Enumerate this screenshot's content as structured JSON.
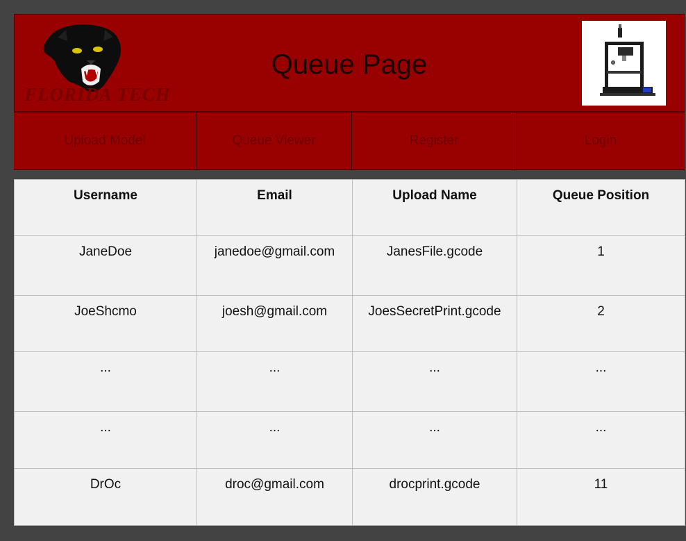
{
  "header": {
    "title": "Queue Page",
    "logo_text": "FLORIDA TECH",
    "colors": {
      "brand": "#990000",
      "nav": "#990000",
      "background": "#434343",
      "table": "#f1f1f1"
    }
  },
  "nav": {
    "items": [
      {
        "label": "Upload Model"
      },
      {
        "label": "Queue Viewer"
      },
      {
        "label": "Register"
      },
      {
        "label": "Login"
      }
    ]
  },
  "table": {
    "columns": [
      "Username",
      "Email",
      "Upload Name",
      "Queue Position"
    ],
    "rows": [
      [
        "JaneDoe",
        "janedoe@gmail.com",
        "JanesFile.gcode",
        "1"
      ],
      [
        "JoeShcmo",
        "joesh@gmail.com",
        "JoesSecretPrint.gcode",
        "2"
      ],
      [
        "...",
        "...",
        "...",
        "..."
      ],
      [
        "...",
        "...",
        "...",
        "..."
      ],
      [
        "DrOc",
        "droc@gmail.com",
        "drocprint.gcode",
        "11"
      ]
    ]
  }
}
